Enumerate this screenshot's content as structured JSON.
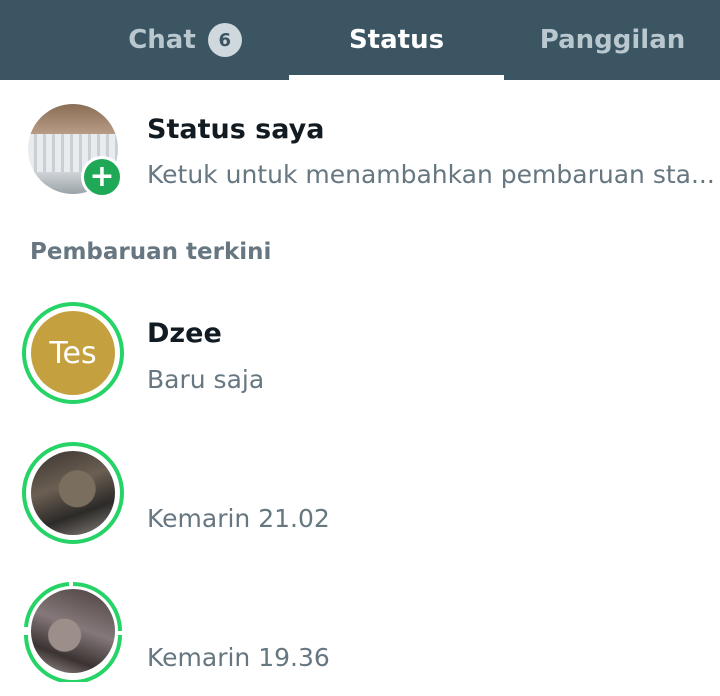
{
  "tabs": {
    "chat_label": "Chat",
    "chat_badge": "6",
    "status_label": "Status",
    "calls_label": "Panggilan",
    "active": "Status"
  },
  "my_status": {
    "title": "Status saya",
    "subtitle": "Ketuk untuk menambahkan pembaruan sta..."
  },
  "recent_section_label": "Pembaruan terkini",
  "updates": [
    {
      "name": "Dzee",
      "avatar_text": "Tes",
      "time": "Baru saja"
    },
    {
      "name": "",
      "time": "Kemarin 21.02"
    },
    {
      "name": "",
      "time": "Kemarin 19.36"
    }
  ],
  "colors": {
    "header_bg": "#3b5563",
    "accent_green": "#25d366",
    "add_badge_green": "#1fa855",
    "avatar_tes_bg": "#c4a03f",
    "secondary_text": "#667781"
  }
}
